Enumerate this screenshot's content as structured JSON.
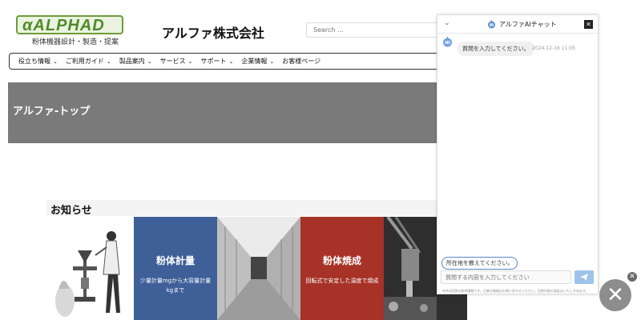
{
  "header": {
    "logo_text": "αALPHAD",
    "logo_tagline": "粉体機器設計・製造・提案",
    "company_name": "アルファ株式会社",
    "search_placeholder": "Search ..."
  },
  "nav": {
    "items": [
      {
        "label": "役立ち情報"
      },
      {
        "label": "ご利用ガイド"
      },
      {
        "label": "製品案内"
      },
      {
        "label": "サービス"
      },
      {
        "label": "サポート"
      },
      {
        "label": "企業情報"
      },
      {
        "label": "お客様ページ"
      }
    ]
  },
  "hero": {
    "title": "アルファ-トップ"
  },
  "news": {
    "title": "お知らせ",
    "tiles": [
      {
        "kind": "image",
        "icon": "scientist-illustration"
      },
      {
        "kind": "text",
        "heading": "粉体計量",
        "body": "少量計量mgから大容量計量kgまで",
        "color": "#3f5f98"
      },
      {
        "kind": "image",
        "icon": "corridor-photo"
      },
      {
        "kind": "text",
        "heading": "粉体焼成",
        "body": "回転式で安定した温度で焼成",
        "color": "#a63228"
      },
      {
        "kind": "image",
        "icon": "machine-photo"
      }
    ]
  },
  "chat": {
    "title": "アルファAIチャット",
    "bot_message": "質問を入力してください。",
    "bot_time": "2024-12-16 11:05",
    "suggestion": "所在地を教えてください。",
    "input_placeholder": "質問する内容を入力してください",
    "footer_note": "※AIの回答は参考情報です。正確な情報はお問い合わせください。回答内容の保証はいたしかねます。"
  },
  "colors": {
    "accent": "#4f8a2b",
    "hero_bg": "#7a7a7a",
    "send_button": "#9ec3ea"
  }
}
